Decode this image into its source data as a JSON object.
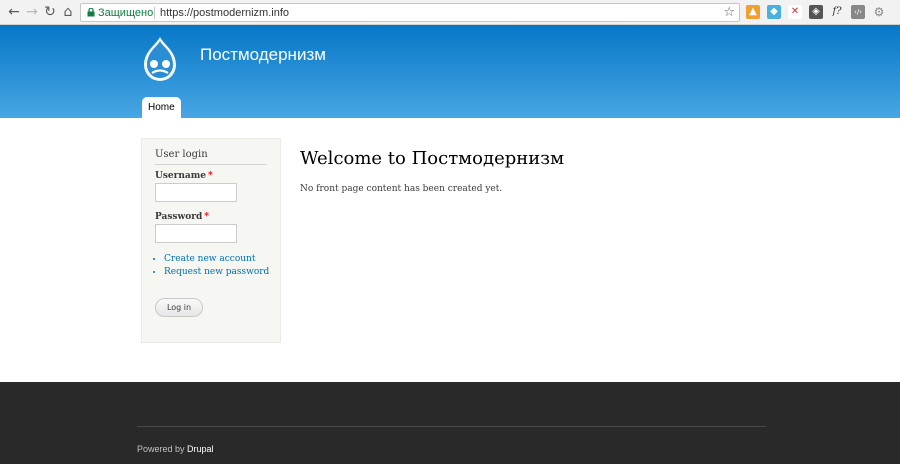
{
  "browser": {
    "secure_label": "Защищено",
    "url": "https://postmodernizm.info",
    "extensions": [
      {
        "name": "ext-1",
        "glyph": "▲",
        "color": "#f0a030"
      },
      {
        "name": "ext-2",
        "glyph": "◆",
        "color": "#4ab0e0"
      },
      {
        "name": "ext-3",
        "glyph": "✕",
        "color": "#d03030"
      },
      {
        "name": "ext-4",
        "glyph": "◈",
        "color": "#555555"
      },
      {
        "name": "ext-5",
        "glyph": "f?",
        "color": "#333333"
      },
      {
        "name": "ext-6",
        "glyph": "‹/›",
        "color": "#888888"
      },
      {
        "name": "ext-7",
        "glyph": "⚙",
        "color": "#c8c8c8"
      }
    ]
  },
  "header": {
    "site_name": "Постмодернизм",
    "tab_home": "Home",
    "header_color": "#0677c7"
  },
  "sidebar": {
    "block_title": "User login",
    "username_label": "Username",
    "password_label": "Password",
    "required_mark": "*",
    "username_value": "",
    "password_value": "",
    "links": [
      "Create new account",
      "Request new password"
    ],
    "login_button": "Log in"
  },
  "main": {
    "title": "Welcome to Постмодернизм",
    "text": "No front page content has been created yet."
  },
  "footer": {
    "powered_by": "Powered by",
    "drupal_link": "Drupal"
  }
}
